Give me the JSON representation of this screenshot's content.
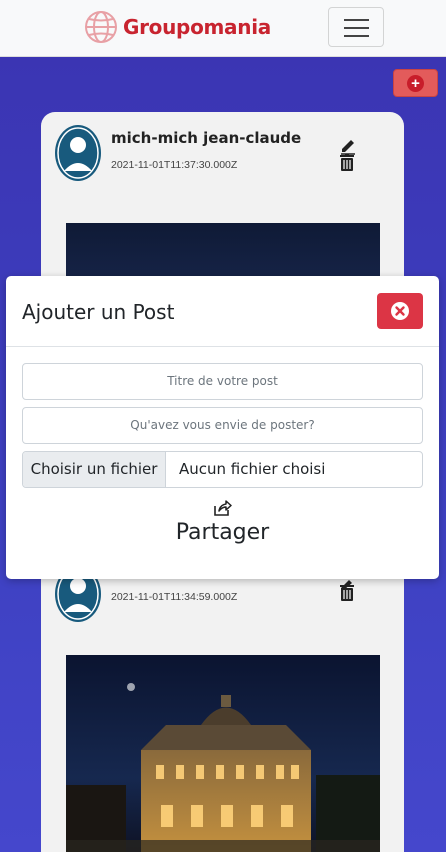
{
  "navbar": {
    "brand": "Groupomania",
    "menu_icon": "hamburger-icon"
  },
  "actions": {
    "add_post_icon": "plus-circle-icon"
  },
  "posts": [
    {
      "author": "mich-mich jean-claude",
      "date": "2021-11-01T11:37:30.000Z"
    },
    {
      "author": "",
      "date": "2021-11-01T11:34:59.000Z"
    }
  ],
  "modal": {
    "title": "Ajouter un Post",
    "close_icon": "close-circle-icon",
    "title_placeholder": "Titre de votre post",
    "content_placeholder": "Qu'avez vous envie de poster?",
    "file_button": "Choisir un fichier",
    "file_status": "Aucun fichier choisi",
    "share_icon": "share-icon",
    "share_label": "Partager"
  },
  "colors": {
    "brand": "#c8242f",
    "background": "#3a3bb5",
    "danger": "#dc3545",
    "add_button": "#e35b5b"
  }
}
